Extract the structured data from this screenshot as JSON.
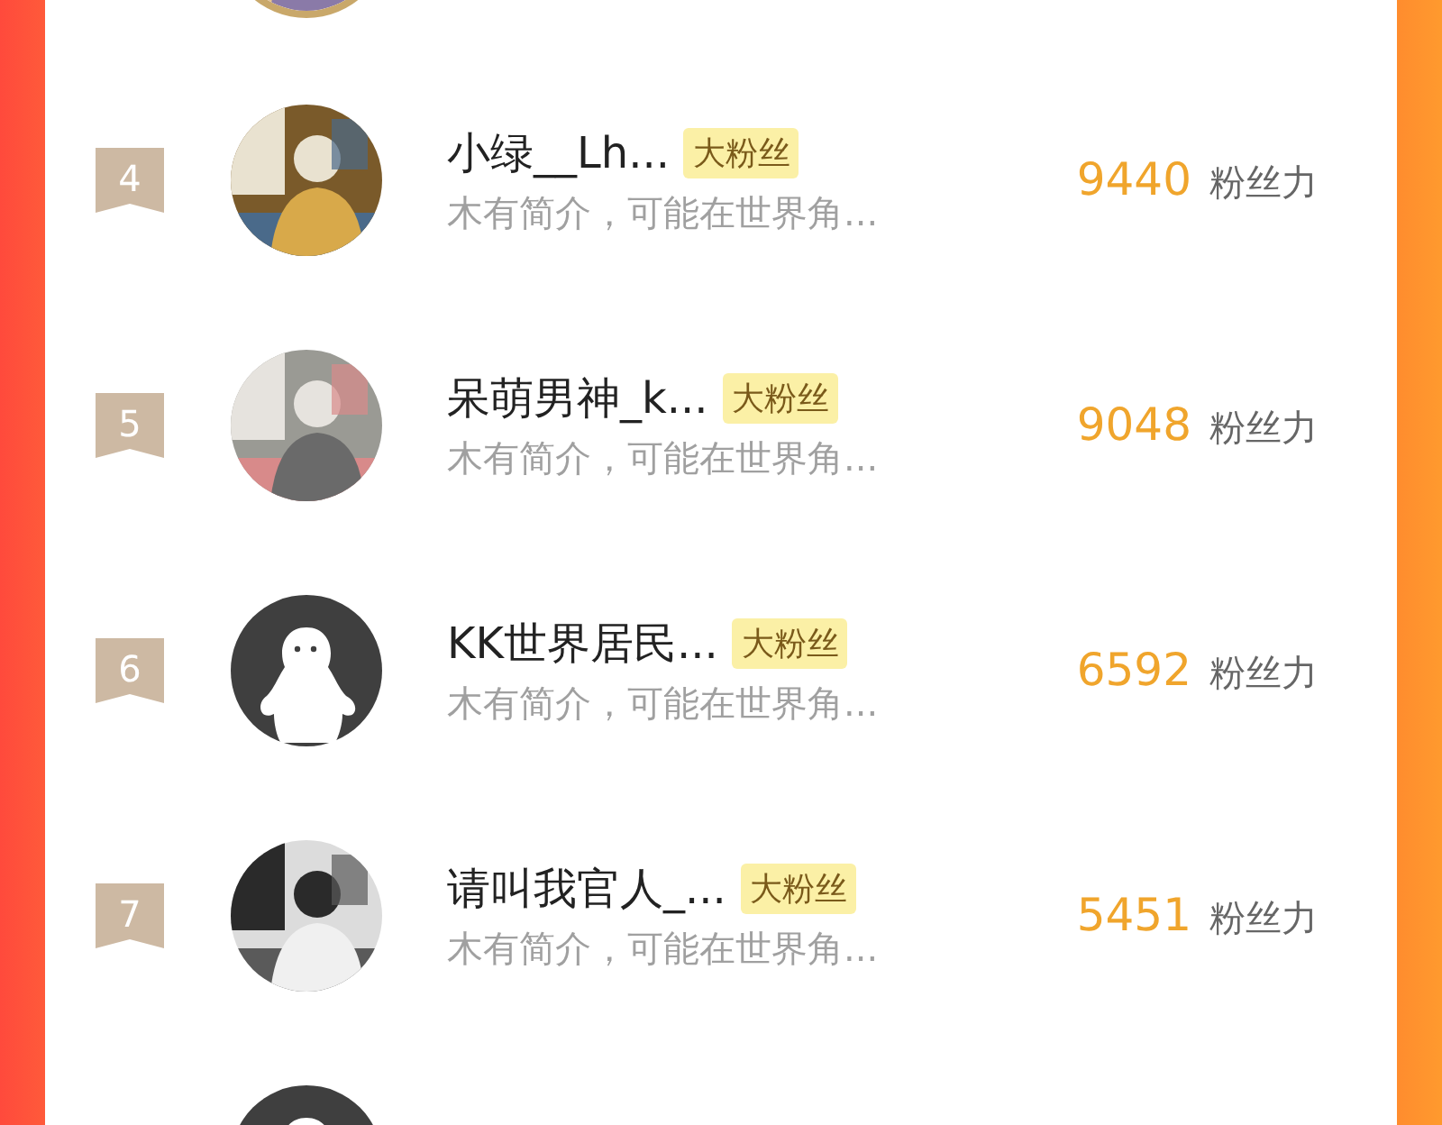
{
  "rows": [
    {
      "kind": "partial"
    },
    {
      "kind": "full",
      "rank": "4",
      "name": "小绿__Lh...",
      "badge": "大粉丝",
      "bio": "木有简介，可能在世界角...",
      "score": "9440",
      "score_label": "粉丝力"
    },
    {
      "kind": "full",
      "rank": "5",
      "name": "呆萌男神_k...",
      "badge": "大粉丝",
      "bio": "木有简介，可能在世界角...",
      "score": "9048",
      "score_label": "粉丝力"
    },
    {
      "kind": "full",
      "avatar": {
        "kind": "default"
      },
      "rank": "6",
      "name": "KK世界居民...",
      "badge": "大粉丝",
      "bio": "木有简介，可能在世界角...",
      "score": "6592",
      "score_label": "粉丝力"
    },
    {
      "kind": "full",
      "rank": "7",
      "name": "请叫我官人_...",
      "badge": "大粉丝",
      "bio": "木有简介，可能在世界角...",
      "score": "5451",
      "score_label": "粉丝力"
    },
    {
      "kind": "partial",
      "avatar": {
        "kind": "default"
      }
    }
  ]
}
